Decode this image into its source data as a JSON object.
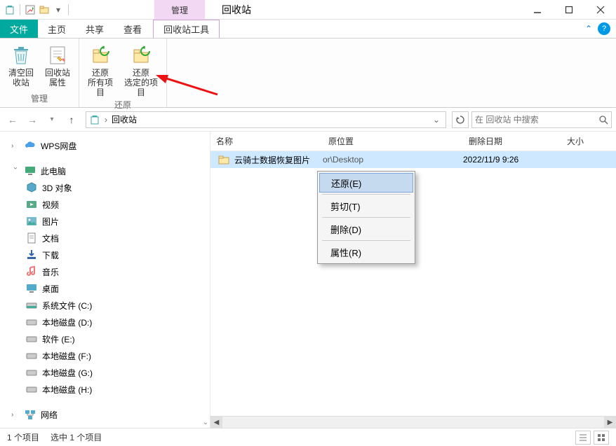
{
  "titlebar": {
    "manage": "管理",
    "recycle_bin": "回收站"
  },
  "ribbon_tabs": {
    "file": "文件",
    "home": "主页",
    "share": "共享",
    "view": "查看",
    "recycle_tools": "回收站工具"
  },
  "ribbon": {
    "empty_bin": "清空回\n收站",
    "bin_props": "回收站\n属性",
    "restore_all": "还原\n所有项目",
    "restore_selected": "还原\n选定的项目",
    "group_manage": "管理",
    "group_restore": "还原"
  },
  "nav": {
    "location": "回收站",
    "search_placeholder": "在 回收站 中搜索"
  },
  "tree": {
    "wps": "WPS网盘",
    "this_pc": "此电脑",
    "items": [
      "3D 对象",
      "视频",
      "图片",
      "文档",
      "下载",
      "音乐",
      "桌面",
      "系统文件 (C:)",
      "本地磁盘 (D:)",
      "软件 (E:)",
      "本地磁盘 (F:)",
      "本地磁盘 (G:)",
      "本地磁盘 (H:)"
    ],
    "network": "网络"
  },
  "columns": {
    "name": "名称",
    "original_location": "原位置",
    "date_deleted": "删除日期",
    "size": "大小"
  },
  "file": {
    "name": "云骑士数据恢复图片",
    "orig": "Desktop",
    "orig_prefix": "or\\",
    "date": "2022/11/9 9:26"
  },
  "context_menu": {
    "restore": "还原(E)",
    "cut": "剪切(T)",
    "delete": "删除(D)",
    "properties": "属性(R)"
  },
  "statusbar": {
    "total": "1 个项目",
    "selected": "选中 1 个项目"
  }
}
